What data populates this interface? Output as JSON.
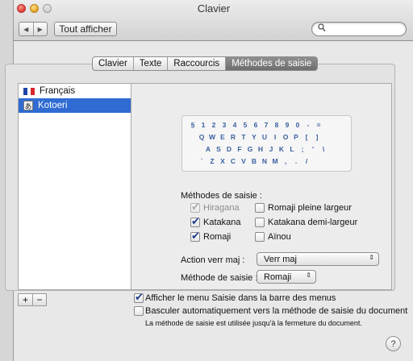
{
  "window": {
    "title": "Clavier"
  },
  "toolbar": {
    "back_glyph": "◀",
    "forward_glyph": "▶",
    "show_all_label": "Tout afficher",
    "search_placeholder": "",
    "search_icon": "search-icon"
  },
  "tabs": [
    {
      "label": "Clavier",
      "active": false
    },
    {
      "label": "Texte",
      "active": false
    },
    {
      "label": "Raccourcis",
      "active": false
    },
    {
      "label": "Méthodes de saisie",
      "active": true
    }
  ],
  "input_sources": [
    {
      "label": "Français",
      "icon": "french-flag-icon",
      "selected": false
    },
    {
      "label": "Kotoeri",
      "icon": "kotoeri-icon",
      "icon_glyph": "あ",
      "selected": true
    }
  ],
  "keyboard_preview": {
    "rows": [
      [
        "§",
        "1",
        "2",
        "3",
        "4",
        "5",
        "6",
        "7",
        "8",
        "9",
        "0",
        "-",
        "="
      ],
      [
        "Q",
        "W",
        "E",
        "R",
        "T",
        "Y",
        "U",
        "I",
        "O",
        "P",
        "[",
        "]"
      ],
      [
        "A",
        "S",
        "D",
        "F",
        "G",
        "H",
        "J",
        "K",
        "L",
        ";",
        "'",
        "\\"
      ],
      [
        "`",
        "Z",
        "X",
        "C",
        "V",
        "B",
        "N",
        "M",
        ",",
        ".",
        "/"
      ]
    ]
  },
  "input_modes": {
    "heading": "Méthodes de saisie :",
    "options": [
      {
        "label": "Hiragana",
        "checked": true,
        "enabled": false
      },
      {
        "label": "Romaji pleine largeur",
        "checked": false,
        "enabled": true
      },
      {
        "label": "Katakana",
        "checked": true,
        "enabled": true
      },
      {
        "label": "Katakana demi-largeur",
        "checked": false,
        "enabled": true
      },
      {
        "label": "Romaji",
        "checked": true,
        "enabled": true
      },
      {
        "label": "Aïnou",
        "checked": false,
        "enabled": true
      }
    ]
  },
  "caps_lock": {
    "label": "Action verr maj :",
    "value": "Verr maj"
  },
  "input_method": {
    "label": "Méthode de saisie :",
    "value": "Romaji"
  },
  "list_controls": {
    "add_label": "+",
    "remove_label": "−"
  },
  "bottom_options": [
    {
      "label": "Afficher le menu Saisie dans la barre des menus",
      "checked": true
    },
    {
      "label": "Basculer automatiquement vers la méthode de saisie du document",
      "checked": false
    }
  ],
  "bottom_note": "La méthode de saisie est utilisée jusqu'à la fermeture du document.",
  "help_label": "?",
  "colors": {
    "selection": "#2f6bd2",
    "active_tab": "#7a7a7a",
    "key_label": "#3a5f9f",
    "checkmark": "#1a3a8c"
  }
}
